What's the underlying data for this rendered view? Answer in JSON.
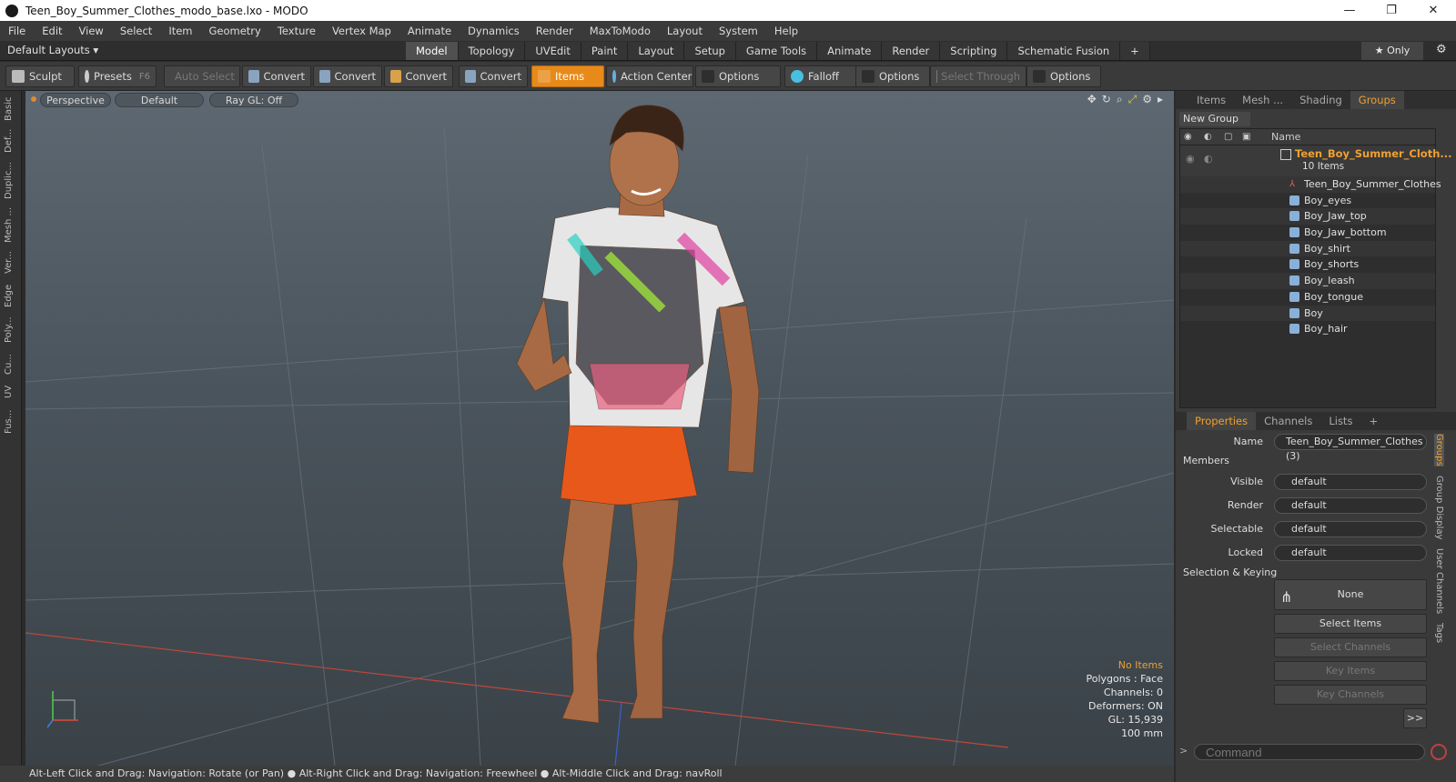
{
  "window": {
    "title": "Teen_Boy_Summer_Clothes_modo_base.lxo - MODO"
  },
  "menu": [
    "File",
    "Edit",
    "View",
    "Select",
    "Item",
    "Geometry",
    "Texture",
    "Vertex Map",
    "Animate",
    "Dynamics",
    "Render",
    "MaxToModo",
    "Layout",
    "System",
    "Help"
  ],
  "layouts": {
    "label": "Default Layouts ▾"
  },
  "tabs": [
    "Model",
    "Topology",
    "UVEdit",
    "Paint",
    "Layout",
    "Setup",
    "Game Tools",
    "Animate",
    "Render",
    "Scripting",
    "Schematic Fusion",
    "+"
  ],
  "only_label": "★  Only",
  "toolbar": {
    "sculpt": "Sculpt",
    "presets": "Presets",
    "presets_key": "F6",
    "auto_select": "Auto Select",
    "convert1": "Convert",
    "convert2": "Convert",
    "convert3": "Convert",
    "convert4": "Convert",
    "items": "Items",
    "action_center": "Action Center",
    "options1": "Options",
    "falloff": "Falloff",
    "options2": "Options",
    "select_through": "Select Through",
    "options3": "Options"
  },
  "left_tabs": [
    "Basic",
    "Def...",
    "Duplic...",
    "Mesh ...",
    "Ver...",
    "Edge",
    "Poly...",
    "Cu...",
    "UV",
    "Fus..."
  ],
  "viewport": {
    "view": "Perspective",
    "shading": "Default",
    "raygl": "Ray GL: Off",
    "hud": {
      "selection": "No Items",
      "polygons": "Polygons : Face",
      "channels": "Channels: 0",
      "deformers": "Deformers: ON",
      "gl": "GL: 15,939",
      "scale": "100 mm"
    }
  },
  "status": "Alt-Left Click and Drag: Navigation: Rotate (or Pan) ● Alt-Right Click and Drag: Navigation: Freewheel ● Alt-Middle Click and Drag: navRoll",
  "panel_tabs": [
    "Items",
    "Mesh ...",
    "Shading",
    "Groups"
  ],
  "new_group": "New Group",
  "tree": {
    "col_name": "Name",
    "root_name": "Teen_Boy_Summer_Cloth...",
    "root_count": "10 Items",
    "items": [
      "Teen_Boy_Summer_Clothes",
      "Boy_eyes",
      "Boy_Jaw_top",
      "Boy_Jaw_bottom",
      "Boy_shirt",
      "Boy_shorts",
      "Boy_leash",
      "Boy_tongue",
      "Boy",
      "Boy_hair"
    ]
  },
  "props_tabs": [
    "Properties",
    "Channels",
    "Lists",
    "+"
  ],
  "properties": {
    "name_label": "Name",
    "name_value": "Teen_Boy_Summer_Clothes (3)",
    "members": "Members",
    "visible_label": "Visible",
    "render_label": "Render",
    "selectable_label": "Selectable",
    "locked_label": "Locked",
    "default": "default",
    "sel_keying": "Selection & Keying",
    "none": "None",
    "select_items": "Select Items",
    "select_channels": "Select Channels",
    "key_items": "Key Items",
    "key_channels": "Key Channels",
    "more": ">>"
  },
  "side_vtabs": [
    "Groups",
    "Group Display",
    "User Channels",
    "Tags"
  ],
  "command_placeholder": "Command"
}
